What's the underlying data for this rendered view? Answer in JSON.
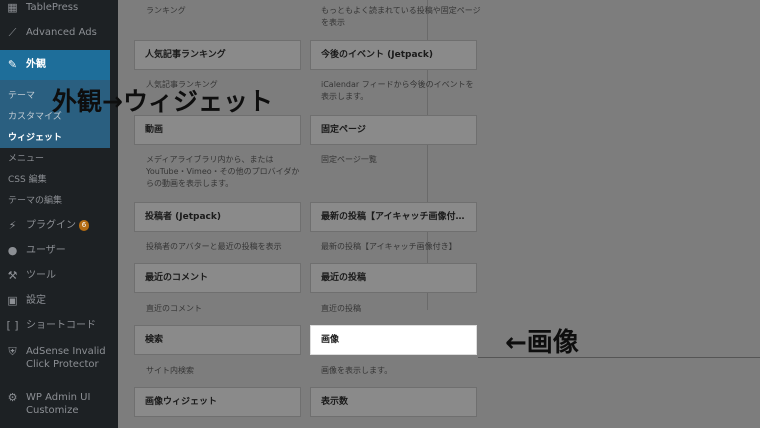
{
  "sidebar": {
    "items": [
      {
        "label": "TablePress",
        "icon": "table-icon"
      },
      {
        "label": "Advanced Ads",
        "icon": "chart-line-icon"
      },
      {
        "label": "外観",
        "icon": "paintbrush-icon"
      },
      {
        "label": "プラグイン",
        "icon": "plugin-icon",
        "badge": "6"
      },
      {
        "label": "ユーザー",
        "icon": "user-icon"
      },
      {
        "label": "ツール",
        "icon": "wrench-icon"
      },
      {
        "label": "設定",
        "icon": "settings-icon"
      },
      {
        "label": "ショートコード",
        "icon": "shortcode-icon"
      },
      {
        "label_line1": "AdSense Invalid",
        "label_line2": "Click Protector",
        "icon": "shield-icon"
      },
      {
        "label_line1": "WP Admin UI",
        "label_line2": "Customize",
        "icon": "gear-icon"
      }
    ],
    "submenu": [
      "テーマ",
      "カスタマイズ",
      "ウィジェット",
      "メニュー",
      "CSS 編集",
      "テーマの編集"
    ]
  },
  "widgets": {
    "top_left_desc": "ランキング",
    "top_right_desc": "もっともよく読まれている投稿や固定ページを表示",
    "rows": [
      {
        "left": {
          "title": "人気記事ランキング",
          "desc": "人気記事ランキング"
        },
        "right": {
          "title": "今後のイベント (Jetpack)",
          "desc": "iCalendar フィードから今後のイベントを表示します。"
        }
      },
      {
        "left": {
          "title": "動画",
          "desc": "メディアライブラリ内から、または YouTube・Vimeo・その他のプロバイダからの動画を表示します。"
        },
        "right": {
          "title": "固定ページ",
          "desc": "固定ページ一覧"
        }
      },
      {
        "left": {
          "title": "投稿者 (Jetpack)",
          "desc": "投稿者のアバターと最近の投稿を表示"
        },
        "right": {
          "title": "最新の投稿【アイキャッチ画像付…",
          "desc": "最新の投稿【アイキャッチ画像付き】"
        }
      },
      {
        "left": {
          "title": "最近のコメント",
          "desc": "直近のコメント"
        },
        "right": {
          "title": "最近の投稿",
          "desc": "直近の投稿"
        }
      },
      {
        "left": {
          "title": "検索",
          "desc": "サイト内検索"
        },
        "right": {
          "title": "画像",
          "desc": "画像を表示します。"
        }
      },
      {
        "left": {
          "title": "画像ウィジェット",
          "desc": ""
        },
        "right": {
          "title": "表示数",
          "desc": ""
        }
      }
    ]
  },
  "annotations": {
    "nav_label": "外観→ウィジェット",
    "image_label": "←画像"
  }
}
